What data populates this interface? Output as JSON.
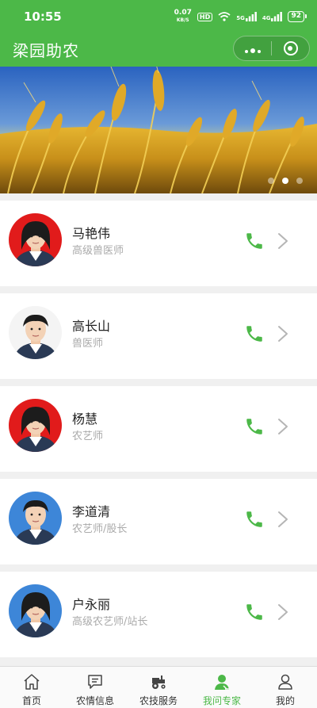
{
  "status_bar": {
    "time": "10:55",
    "net_speed": "0.07",
    "net_unit": "KB/S",
    "hd": "HD",
    "signal_1": "5G",
    "signal_2": "4G",
    "battery": "92"
  },
  "header": {
    "title": "梁园助农"
  },
  "banner": {
    "image": "wheat-field-photo",
    "slide_count": 3,
    "active_slide": 2
  },
  "experts": [
    {
      "name": "马艳伟",
      "title": "高级兽医师",
      "avatar_bg": "#e11b1b",
      "gender": "female"
    },
    {
      "name": "高长山",
      "title": "兽医师",
      "avatar_bg": "#f4f4f4",
      "gender": "male"
    },
    {
      "name": "杨慧",
      "title": "农艺师",
      "avatar_bg": "#e11b1b",
      "gender": "female"
    },
    {
      "name": "李道清",
      "title": "农艺师/股长",
      "avatar_bg": "#3d86d8",
      "gender": "male"
    },
    {
      "name": "户永丽",
      "title": "高级农艺师/站长",
      "avatar_bg": "#3d86d8",
      "gender": "female"
    }
  ],
  "tabbar": [
    {
      "label": "首页",
      "icon": "home-icon",
      "active": false
    },
    {
      "label": "农情信息",
      "icon": "message-icon",
      "active": false
    },
    {
      "label": "农技服务",
      "icon": "tractor-icon",
      "active": false
    },
    {
      "label": "我问专家",
      "icon": "expert-icon",
      "active": true
    },
    {
      "label": "我的",
      "icon": "user-icon",
      "active": false
    }
  ],
  "colors": {
    "brand": "#4cb848",
    "phone_icon": "#4cb848",
    "muted_text": "#aaaaaa"
  }
}
